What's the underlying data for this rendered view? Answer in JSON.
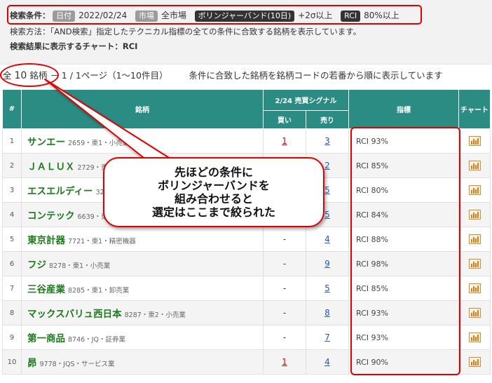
{
  "conditions": {
    "label": "検索条件：",
    "date_tag": "日付",
    "date_value": "2022/02/24",
    "market_tag": "市場",
    "market_value": "全市場",
    "indicator_tag": "ボリンジャーバンド(10日)",
    "indicator_value": "+2σ以上",
    "rci_tag": "RCI",
    "rci_value": "80%以上",
    "method": "検索方法：「AND検索」指定したテクニカル指標の全ての条件に合致する銘柄を表示しています。",
    "chart": "検索結果に表示するチャート：RCI"
  },
  "summary": {
    "prefix": "全",
    "count": "10",
    "suffix": "銘柄",
    "pages": "－ 1 / 1ページ（1～10件目）",
    "note": "条件に合致した銘柄を銘柄コードの若番から順に表示しています"
  },
  "table": {
    "headers": {
      "num": "#",
      "name": "銘柄",
      "signal": "2/24 売買シグナル",
      "buy": "買い",
      "sell": "売り",
      "indicator": "指標",
      "chart": "チャート"
    },
    "rows": [
      {
        "num": "1",
        "name": "サンエー",
        "info": "2659・東1・小売業",
        "buy": "1",
        "sell": "3",
        "rci": "RCI 93%"
      },
      {
        "num": "2",
        "name": "ＪＡＬＵＸ",
        "info": "2729・東1・卸売業",
        "buy": "-",
        "sell": "2",
        "rci": "RCI 85%"
      },
      {
        "num": "3",
        "name": "エスエルディー",
        "info": "3223・JQ・小売業",
        "buy": "-",
        "sell": "5",
        "rci": "RCI 80%"
      },
      {
        "num": "4",
        "name": "コンテック",
        "info": "6639・東2・電気機器",
        "buy": "-",
        "sell": "5",
        "rci": "RCI 84%"
      },
      {
        "num": "5",
        "name": "東京計器",
        "info": "7721・東1・精密機器",
        "buy": "-",
        "sell": "4",
        "rci": "RCI 88%"
      },
      {
        "num": "6",
        "name": "フジ",
        "info": "8278・東1・小売業",
        "buy": "-",
        "sell": "9",
        "rci": "RCI 98%"
      },
      {
        "num": "7",
        "name": "三谷産業",
        "info": "8285・東1・卸売業",
        "buy": "-",
        "sell": "5",
        "rci": "RCI 85%"
      },
      {
        "num": "8",
        "name": "マックスバリュ西日本",
        "info": "8287・東2・小売業",
        "buy": "-",
        "sell": "8",
        "rci": "RCI 93%"
      },
      {
        "num": "9",
        "name": "第一商品",
        "info": "8746・JQ・証券業",
        "buy": "-",
        "sell": "7",
        "rci": "RCI 93%"
      },
      {
        "num": "10",
        "name": "昴",
        "info": "9778・JQS・サービス業",
        "buy": "1",
        "sell": "4",
        "rci": "RCI 90%"
      }
    ]
  },
  "callout": {
    "lines": [
      "先ほどの条件に",
      "ボリンジャーバンドを",
      "組み合わせると",
      "選定はここまで絞られた"
    ]
  },
  "colors": {
    "header": "#2b8c84",
    "name": "#1c7a1c",
    "highlight": "#e00000",
    "link": "#2255bb"
  }
}
